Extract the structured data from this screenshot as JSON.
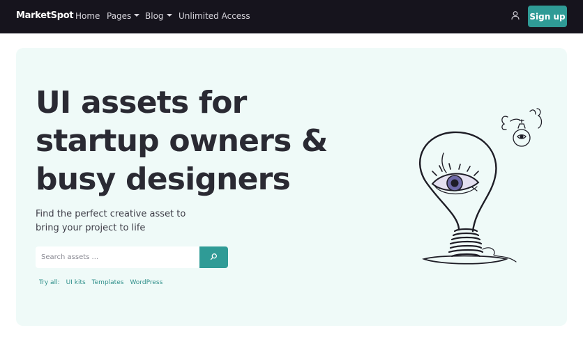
{
  "navbar": {
    "brand": "MarketSpot",
    "links": [
      {
        "label": "Home"
      },
      {
        "label": "Pages"
      },
      {
        "label": "Blog"
      },
      {
        "label": "Unlimited Access"
      }
    ],
    "signup_label": "Sign up",
    "user_icon": "user-icon"
  },
  "hero": {
    "title": "UI assets for startup owners & busy designers",
    "subtitle": "Find the perfect creative asset to bring your project to life",
    "search": {
      "placeholder": "Search assets ...",
      "value": "",
      "button_icon": "search-icon"
    },
    "try_all": {
      "label": "Try all:",
      "items": [
        "UI kits",
        "Templates",
        "WordPress"
      ]
    }
  },
  "colors": {
    "navbar_bg": "#16141d",
    "accent": "#2f9b96",
    "hero_bg": "#effaf8",
    "text": "#2a2a33"
  }
}
